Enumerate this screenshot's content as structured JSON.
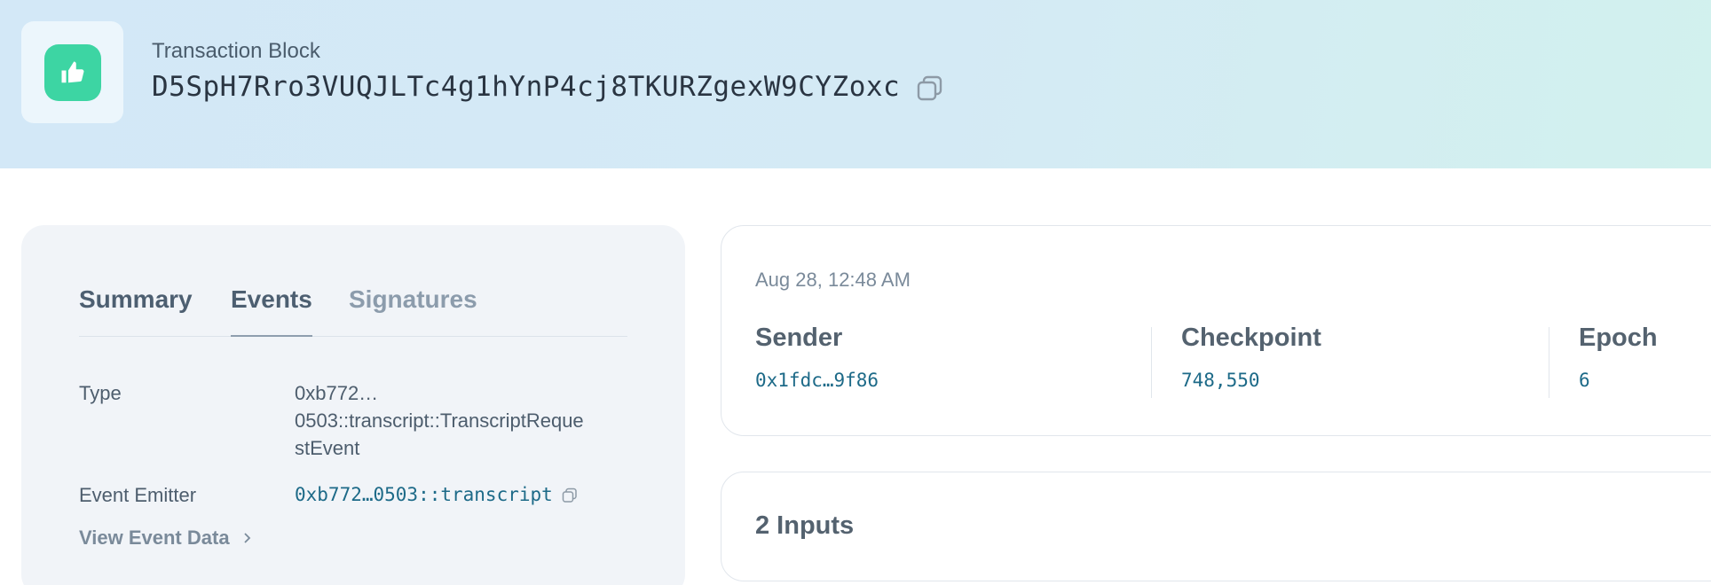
{
  "header": {
    "label": "Transaction Block",
    "tx_id": "D5SpH7Rro3VUQJLTc4g1hYnP4cj8TKURZgexW9CYZoxc",
    "status_icon": "thumbs-up-icon",
    "status_color": "#3dd5a3"
  },
  "tabs": [
    {
      "label": "Summary"
    },
    {
      "label": "Events",
      "active": true
    },
    {
      "label": "Signatures"
    }
  ],
  "event": {
    "type_label": "Type",
    "type_value_line1": "0xb772…",
    "type_value_line2": "0503::transcript::TranscriptReque",
    "type_value_line3": "stEvent",
    "emitter_label": "Event Emitter",
    "emitter_value": "0xb772…0503::transcript",
    "view_link": "View Event Data"
  },
  "info": {
    "date": "Aug 28, 12:48 AM",
    "sender_label": "Sender",
    "sender_value": "0x1fdc…9f86",
    "checkpoint_label": "Checkpoint",
    "checkpoint_value": "748,550",
    "epoch_label": "Epoch",
    "epoch_value": "6"
  },
  "inputs": {
    "title": "2 Inputs"
  },
  "colors": {
    "link": "#1d6a88",
    "header_bg": "#d3e8f7"
  }
}
